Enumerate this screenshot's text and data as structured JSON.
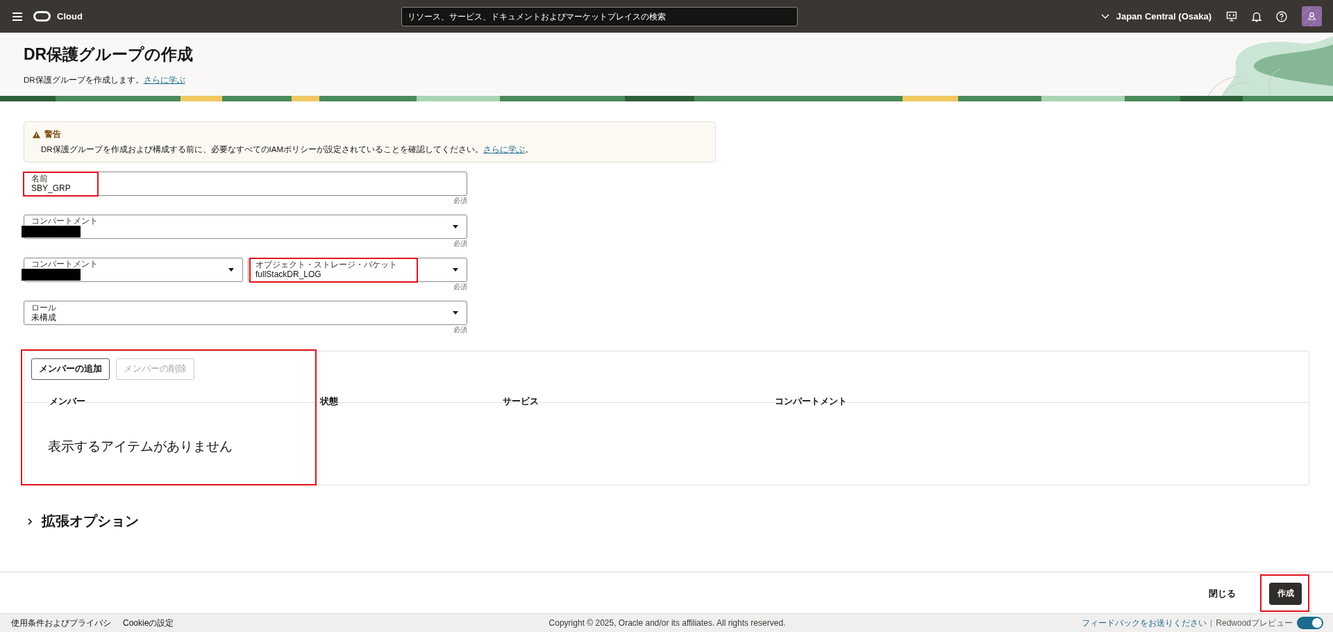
{
  "topbar": {
    "logo_text": "Cloud",
    "search_placeholder": "リソース、サービス、ドキュメントおよびマーケットプレイスの検索",
    "region": "Japan Central (Osaka)"
  },
  "header": {
    "title": "DR保護グループの作成",
    "description": "DR保護グループを作成します。",
    "link": "さらに学ぶ"
  },
  "warning": {
    "title": "警告",
    "text": "DR保護グループを作成および構成する前に、必要なすべてのIAMポリシーが設定されていることを確認してください。",
    "link": "さらに学ぶ",
    "end": "。"
  },
  "form_rows": [
    {
      "required_note": "必須",
      "fields": [
        {
          "kind": "text",
          "label": "名前",
          "value": "SBY_GRP",
          "redacted": false,
          "highlighted": true
        }
      ]
    },
    {
      "required_note": "必須",
      "fields": [
        {
          "kind": "select",
          "label": "コンパートメント",
          "redacted": true,
          "highlighted": false
        }
      ]
    },
    {
      "required_note": "必須",
      "fields": [
        {
          "kind": "select",
          "label": "コンパートメント",
          "redacted": true,
          "highlighted": false
        },
        {
          "kind": "select",
          "label": "オブジェクト・ストレージ・バケット",
          "value": "fullStackDR_LOG",
          "redacted": false,
          "highlighted": true
        }
      ]
    },
    {
      "required_note": "必須",
      "fields": [
        {
          "kind": "select",
          "label": "ロール",
          "value": "未構成",
          "redacted": false,
          "highlighted": false
        }
      ]
    }
  ],
  "members": {
    "highlighted": true,
    "buttons": [
      {
        "label": "メンバーの追加",
        "disabled": false
      },
      {
        "label": "メンバーの削除",
        "disabled": true
      }
    ],
    "columns": [
      "メンバー",
      "状態",
      "サービス",
      "コンパートメント"
    ],
    "empty_text": "表示するアイテムがありません"
  },
  "advanced": {
    "label": "拡張オプション",
    "expanded": false
  },
  "actions": [
    {
      "kind": "link",
      "label": "閉じる",
      "highlighted": false
    },
    {
      "kind": "primary",
      "label": "作成",
      "highlighted": true
    }
  ],
  "footer": {
    "links": [
      "使用条件およびプライバシ",
      "Cookieの設定"
    ],
    "copyright": "Copyright © 2025, Oracle and/or its affiliates. All rights reserved.",
    "feedback": "フィードバックをお送りください",
    "preview_label": "Redwoodプレビュー",
    "preview_on": true
  }
}
